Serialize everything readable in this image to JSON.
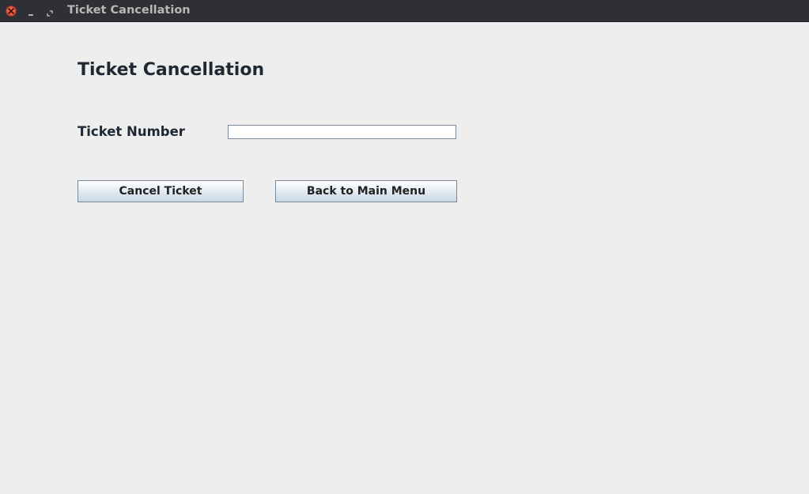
{
  "window": {
    "title": "Ticket Cancellation",
    "controls": {
      "close_icon": "close-icon",
      "minimize_icon": "minimize-icon",
      "maximize_icon": "maximize-icon"
    }
  },
  "form": {
    "heading": "Ticket Cancellation",
    "ticket_number_label": "Ticket Number",
    "ticket_number_value": "",
    "ticket_number_placeholder": ""
  },
  "buttons": {
    "cancel_label": "Cancel Ticket",
    "back_label": "Back to Main Menu"
  },
  "colors": {
    "titlebar": "#2f3036",
    "background": "#eeeeee",
    "close_button": "#e0533b",
    "text": "#1f2933"
  }
}
